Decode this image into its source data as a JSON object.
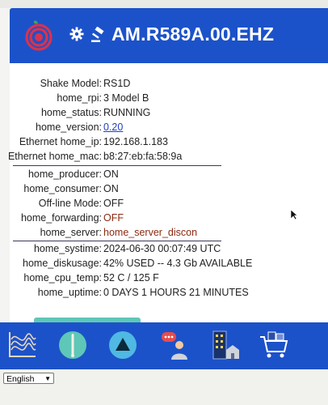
{
  "header": {
    "title": "AM.R589A.00.EHZ",
    "icons": [
      "shake-logo-icon",
      "gear-icon",
      "gavel-icon"
    ],
    "color": "#1c52c9"
  },
  "status": {
    "group1": [
      {
        "label": "Shake Model:",
        "value": "RS1D"
      },
      {
        "label": "home_rpi:",
        "value": "3 Model B"
      },
      {
        "label": "home_status:",
        "value": "RUNNING"
      },
      {
        "label": "home_version:",
        "value": "0.20",
        "style": "link"
      },
      {
        "label": "Ethernet home_ip:",
        "value": "192.168.1.183"
      },
      {
        "label": "Ethernet home_mac:",
        "value": "b8:27:eb:fa:58:9a"
      }
    ],
    "group2": [
      {
        "label": "home_producer:",
        "value": "ON"
      },
      {
        "label": "home_consumer:",
        "value": "ON"
      },
      {
        "label": "Off-line Mode:",
        "value": "OFF"
      },
      {
        "label": "home_forwarding:",
        "value": "OFF",
        "style": "warn"
      },
      {
        "label": "home_server:",
        "value": "home_server_discon",
        "style": "warn"
      }
    ],
    "group3": [
      {
        "label": "home_systime:",
        "value": "2024-06-30 00:07:49 UTC"
      },
      {
        "label": "home_diskusage:",
        "value": "42% USED -- 4.3 Gb AVAILABLE"
      },
      {
        "label": "home_cpu_temp:",
        "value": "52 C / 125 F"
      },
      {
        "label": "home_uptime:",
        "value": "0 DAYS 1 HOURS 21 MINUTES"
      }
    ]
  },
  "footer": {
    "icons": [
      "waveform-icon",
      "compass-icon",
      "triangle-icon",
      "chat-user-icon",
      "building-icon",
      "cart-icon"
    ]
  },
  "language": {
    "selected": "English"
  }
}
